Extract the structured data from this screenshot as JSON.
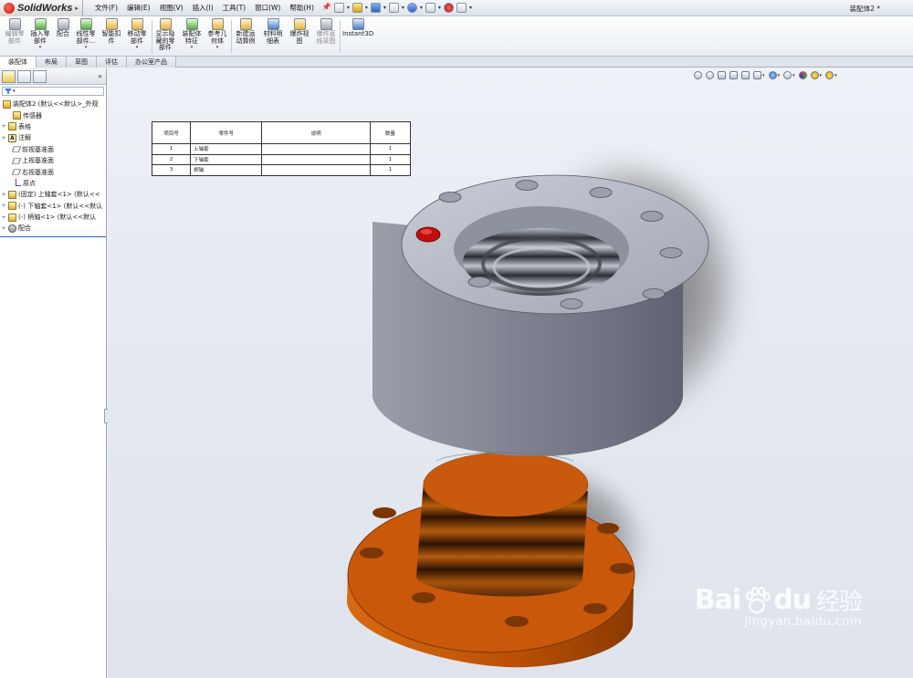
{
  "app": {
    "name": "SolidWorks",
    "document_title": "装配体2 *"
  },
  "menu": [
    "文件(F)",
    "编辑(E)",
    "视图(V)",
    "插入(I)",
    "工具(T)",
    "窗口(W)",
    "帮助(H)"
  ],
  "commands": [
    {
      "label": "编辑零\n部件",
      "icon": "edit-component-icon",
      "enabled": false,
      "dropdown": false
    },
    {
      "label": "插入零\n部件",
      "icon": "insert-component-icon",
      "enabled": true,
      "dropdown": true
    },
    {
      "label": "配合",
      "icon": "mate-icon",
      "enabled": true,
      "dropdown": false
    },
    {
      "label": "线性零\n部件...",
      "icon": "linear-pattern-icon",
      "enabled": true,
      "dropdown": true
    },
    {
      "label": "智能扣\n件",
      "icon": "smart-fastener-icon",
      "enabled": true,
      "dropdown": false
    },
    {
      "label": "移动零\n部件",
      "icon": "move-component-icon",
      "enabled": true,
      "dropdown": true
    },
    {
      "label": "显示隐\n藏的零\n部件",
      "icon": "show-hidden-icon",
      "enabled": true,
      "dropdown": false
    },
    {
      "label": "装配体\n特征",
      "icon": "assembly-feature-icon",
      "enabled": true,
      "dropdown": true
    },
    {
      "label": "参考几\n何体",
      "icon": "reference-geometry-icon",
      "enabled": true,
      "dropdown": true
    },
    {
      "label": "新建运\n动算例",
      "icon": "motion-study-icon",
      "enabled": true,
      "dropdown": false
    },
    {
      "label": "材料明\n细表",
      "icon": "bom-icon",
      "enabled": true,
      "dropdown": false
    },
    {
      "label": "爆炸视\n图",
      "icon": "exploded-view-icon",
      "enabled": true,
      "dropdown": false
    },
    {
      "label": "爆炸直\n线草图",
      "icon": "explode-line-sketch-icon",
      "enabled": false,
      "dropdown": false
    },
    {
      "label": "Instant3D",
      "icon": "instant3d-icon",
      "enabled": true,
      "dropdown": false
    }
  ],
  "tabs": [
    "装配体",
    "布局",
    "草图",
    "评估",
    "办公室产品"
  ],
  "active_tab": "装配体",
  "tree": {
    "root": "装配体2 (默认<<默认>_外观",
    "items": [
      {
        "label": "传感器",
        "icon": "sensor-icon",
        "expand": ""
      },
      {
        "label": "表格",
        "icon": "table-icon",
        "expand": "+"
      },
      {
        "label": "注解",
        "icon": "annotation-icon",
        "expand": "+"
      },
      {
        "label": "前视基准面",
        "icon": "plane-icon",
        "expand": ""
      },
      {
        "label": "上视基准面",
        "icon": "plane-icon",
        "expand": ""
      },
      {
        "label": "右视基准面",
        "icon": "plane-icon",
        "expand": ""
      },
      {
        "label": "原点",
        "icon": "origin-icon",
        "expand": ""
      },
      {
        "label": "(固定) 上轴套<1> (默认<<",
        "icon": "part-icon",
        "expand": "+"
      },
      {
        "label": "(-) 下轴套<1> (默认<<默认",
        "icon": "part-icon",
        "expand": "+"
      },
      {
        "label": "(-) 柄轴<1> (默认<<默认",
        "icon": "part-icon",
        "expand": "+"
      },
      {
        "label": "配合",
        "icon": "mates-icon",
        "expand": "+"
      }
    ]
  },
  "bom": {
    "headers": [
      "项目号",
      "零件号",
      "说明",
      "数量"
    ],
    "rows": [
      [
        "1",
        "上轴套",
        "",
        "1"
      ],
      [
        "2",
        "下轴套",
        "",
        "1"
      ],
      [
        "3",
        "柄轴",
        "",
        "1"
      ]
    ]
  },
  "colors": {
    "sleeve_gray": "#7d8190",
    "base_orange": "#c0550a",
    "viewport_bg": "#e6eaf1",
    "accent_blue": "#2a63c6"
  },
  "watermark": {
    "brand": "Bai",
    "brand2": "du",
    "brand_cn": "经验",
    "url": "jingyan.baidu.com"
  }
}
